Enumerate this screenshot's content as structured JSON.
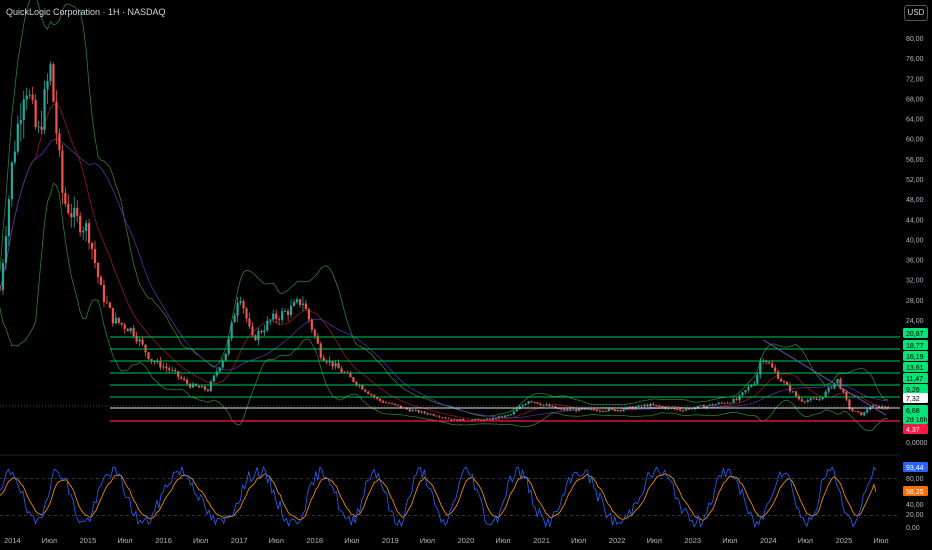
{
  "header": {
    "title": "QuickLogic Corporation · 1H · NASDAQ",
    "currency_button": "USD"
  },
  "colors": {
    "up": "#26a69a",
    "down": "#ef5350",
    "grid_green": "#00c853",
    "support_red": "#ff1744",
    "stoch_k": "#2962ff",
    "stoch_d": "#ff9800",
    "axis_text": "#b2b5be"
  },
  "price_axis_labels": [
    "80,00",
    "76,00",
    "72,00",
    "68,00",
    "64,00",
    "60,00",
    "56,00",
    "52,00",
    "48,00",
    "44,00",
    "40,00",
    "36,00",
    "32,00",
    "28,00",
    "24,00",
    "0,0000"
  ],
  "level_badges": [
    {
      "text": "20,87",
      "kind": "green"
    },
    {
      "text": "18,77",
      "kind": "green"
    },
    {
      "text": "16,19",
      "kind": "green"
    },
    {
      "text": "13,61",
      "kind": "green"
    },
    {
      "text": "11,47",
      "kind": "green"
    },
    {
      "text": "9,26",
      "kind": "green"
    },
    {
      "text": "7,32",
      "kind": "white"
    },
    {
      "text": "6,68",
      "kind": "green"
    },
    {
      "text": "2d 16h",
      "kind": "green"
    },
    {
      "text": "4,37",
      "kind": "red"
    }
  ],
  "oscillator_axis_labels": [
    "80,00",
    "40,00",
    "20,00",
    "0,00"
  ],
  "oscillator_badges": [
    {
      "text": "93,44",
      "kind": "blue"
    },
    {
      "text": "58,35",
      "kind": "orange"
    }
  ],
  "time_axis_labels": [
    "2014",
    "Июл",
    "2015",
    "Июл",
    "2016",
    "Июл",
    "2017",
    "Июл",
    "2018",
    "Июл",
    "2019",
    "Июл",
    "2020",
    "Июл",
    "2021",
    "Июл",
    "2022",
    "Июл",
    "2023",
    "Июл",
    "2024",
    "Июл",
    "2025",
    "Июл"
  ],
  "chart_data": {
    "type": "candlestick",
    "symbol": "QuickLogic Corporation",
    "interval": "1H",
    "exchange": "NASDAQ",
    "ylim": [
      0,
      84
    ],
    "support_resistance_levels": [
      20.87,
      18.77,
      16.19,
      13.61,
      11.47,
      9.26,
      7.32,
      4.37
    ],
    "last_price": 6.68,
    "price_path_approx": [
      [
        "2014-01",
        30
      ],
      [
        "2014-03",
        56
      ],
      [
        "2014-05",
        72
      ],
      [
        "2014-07",
        60
      ],
      [
        "2014-09",
        74
      ],
      [
        "2014-11",
        48
      ],
      [
        "2015-01",
        44
      ],
      [
        "2015-03",
        42
      ],
      [
        "2015-05",
        30
      ],
      [
        "2015-07",
        24
      ],
      [
        "2015-10",
        22
      ],
      [
        "2016-01",
        16
      ],
      [
        "2016-04",
        14
      ],
      [
        "2016-07",
        11
      ],
      [
        "2016-10",
        10
      ],
      [
        "2017-01",
        18
      ],
      [
        "2017-03",
        30
      ],
      [
        "2017-05",
        20
      ],
      [
        "2017-08",
        24
      ],
      [
        "2017-11",
        26
      ],
      [
        "2018-01",
        28
      ],
      [
        "2018-04",
        17
      ],
      [
        "2018-07",
        14
      ],
      [
        "2018-10",
        11
      ],
      [
        "2019-01",
        8
      ],
      [
        "2019-06",
        6
      ],
      [
        "2019-10",
        5
      ],
      [
        "2020-01",
        4
      ],
      [
        "2020-06",
        4
      ],
      [
        "2020-10",
        5
      ],
      [
        "2021-01",
        8
      ],
      [
        "2021-06",
        6
      ],
      [
        "2021-10",
        6
      ],
      [
        "2022-03",
        6
      ],
      [
        "2022-08",
        7
      ],
      [
        "2023-01",
        6
      ],
      [
        "2023-06",
        7
      ],
      [
        "2023-10",
        8
      ],
      [
        "2024-01",
        12
      ],
      [
        "2024-02",
        17
      ],
      [
        "2024-05",
        12
      ],
      [
        "2024-08",
        8
      ],
      [
        "2024-11",
        8
      ],
      [
        "2025-02",
        12
      ],
      [
        "2025-04",
        6
      ],
      [
        "2025-06",
        5
      ],
      [
        "2025-07",
        6.68
      ]
    ],
    "oscillator": {
      "name": "Stochastic",
      "k_last": 93.44,
      "d_last": 58.35,
      "levels": [
        80,
        20
      ]
    }
  }
}
